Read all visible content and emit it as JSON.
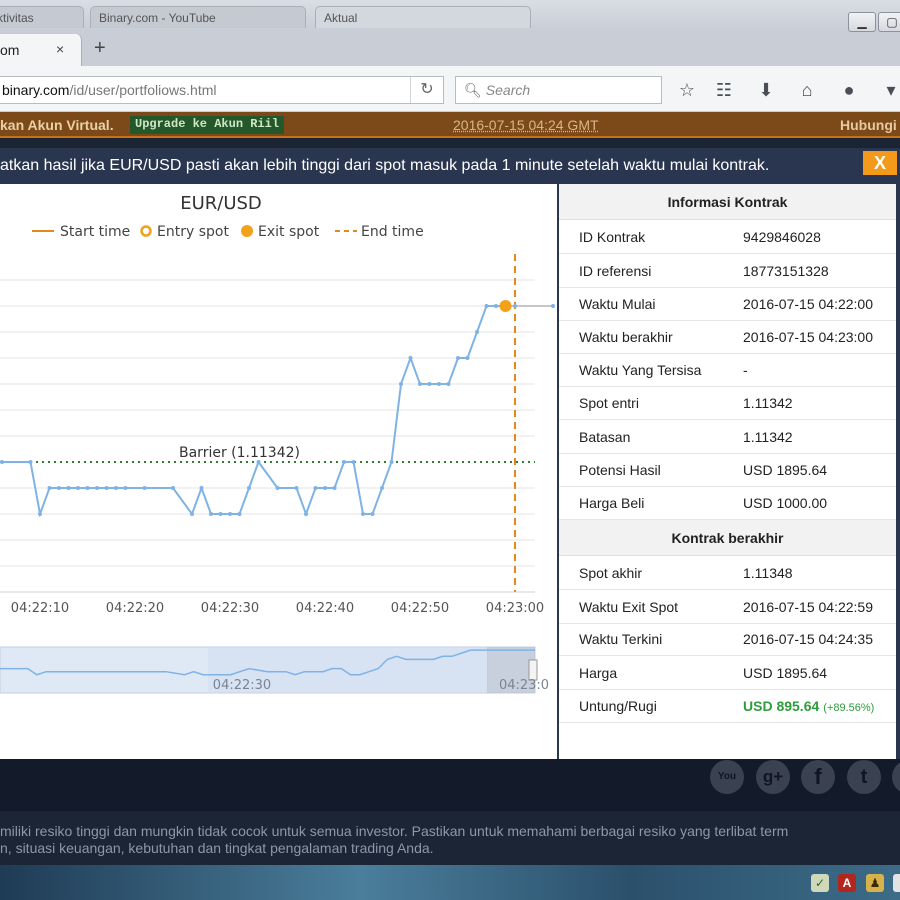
{
  "browser": {
    "tabs": [
      {
        "label": "Aktivitas"
      },
      {
        "label": "Binary.com - YouTube"
      },
      {
        "label": "Aktual"
      }
    ],
    "active_tab": {
      "label": "om",
      "close": "×"
    },
    "new_tab": "+",
    "url_host": "binary.com",
    "url_path": "/id/user/portfoliows.html",
    "search_placeholder": "Search",
    "window_buttons": {
      "minimize": "▁",
      "restore": "▢"
    }
  },
  "site_bar": {
    "left_text": "kan Akun Virtual.",
    "upgrade_label": "Upgrade ke Akun Riil",
    "server_time": "2016-07-15 04:24 GMT",
    "help_label": "Hubungi"
  },
  "dialog": {
    "message": "atkan hasil jika EUR/USD pasti akan lebih tinggi dari spot masuk pada 1 minute setelah waktu mulai kontrak.",
    "close_label": "X"
  },
  "chart_data": {
    "type": "line",
    "title": "EUR/USD",
    "legend": [
      "Start time",
      "Entry spot",
      "Exit spot",
      "End time"
    ],
    "legend_placement": "top",
    "barrier_label": "Barrier (1.11342)",
    "barrier": 1.11342,
    "exit_spot": 1.11348,
    "x_tick_labels": [
      "04:22:10",
      "04:22:20",
      "04:22:30",
      "04:22:40",
      "04:22:50",
      "04:23:00"
    ],
    "x_range_seconds": [
      6,
      64
    ],
    "ylim": [
      1.11337,
      1.1135
    ],
    "grid": true,
    "end_time_second": 60,
    "series": [
      {
        "x": [
          6,
          9,
          10,
          11,
          12,
          13,
          14,
          15,
          16,
          17,
          18,
          19,
          21,
          24,
          26,
          27,
          28,
          29,
          30,
          31,
          32,
          33,
          35,
          37,
          38,
          39,
          40,
          41,
          42,
          43,
          44,
          45,
          46,
          47,
          48,
          49,
          50,
          51,
          52,
          53,
          54,
          55,
          56,
          57,
          58,
          59,
          60,
          64
        ],
        "y": [
          1.11342,
          1.11342,
          1.1134,
          1.11341,
          1.11341,
          1.11341,
          1.11341,
          1.11341,
          1.11341,
          1.11341,
          1.11341,
          1.11341,
          1.11341,
          1.11341,
          1.1134,
          1.11341,
          1.1134,
          1.1134,
          1.1134,
          1.1134,
          1.11341,
          1.11342,
          1.11341,
          1.11341,
          1.1134,
          1.11341,
          1.11341,
          1.11341,
          1.11342,
          1.11342,
          1.1134,
          1.1134,
          1.11341,
          1.11342,
          1.11345,
          1.11346,
          1.11345,
          1.11345,
          1.11345,
          1.11345,
          1.11346,
          1.11346,
          1.11347,
          1.11348,
          1.11348,
          1.11348,
          1.11348,
          1.11348
        ]
      }
    ],
    "navigator_label": "04:22:30",
    "navigator_end_label": "04:23:0"
  },
  "contract_info": {
    "title": "Informasi Kontrak",
    "rows": [
      {
        "label": "ID Kontrak",
        "value": "9429846028"
      },
      {
        "label": "ID referensi",
        "value": "18773151328"
      },
      {
        "label": "Waktu Mulai",
        "value": "2016-07-15 04:22:00"
      },
      {
        "label": "Waktu berakhir",
        "value": "2016-07-15 04:23:00"
      },
      {
        "label": "Waktu Yang Tersisa",
        "value": "-"
      },
      {
        "label": "Spot entri",
        "value": "1.11342"
      },
      {
        "label": "Batasan",
        "value": "1.11342"
      },
      {
        "label": "Potensi Hasil",
        "value": "USD 1895.64"
      },
      {
        "label": "Harga Beli",
        "value": "USD 1000.00"
      }
    ]
  },
  "contract_result": {
    "title": "Kontrak berakhir",
    "rows": [
      {
        "label": "Spot akhir",
        "value": "1.11348"
      },
      {
        "label": "Waktu Exit Spot",
        "value": "2016-07-15 04:22:59"
      },
      {
        "label": "Waktu Terkini",
        "value": "2016-07-15 04:24:35"
      },
      {
        "label": "Harga",
        "value": "USD 1895.64"
      }
    ],
    "profit_label": "Untung/Rugi",
    "profit_value": "USD 895.64",
    "profit_pct": "(+89.56%)",
    "profit_color": "#2e9d3c"
  },
  "footer": {
    "social_icons": [
      "youtube-icon",
      "google-plus-icon",
      "facebook-icon",
      "twitter-icon"
    ],
    "social_glyphs": [
      "You",
      "g+",
      "f",
      "t"
    ],
    "disclaimer_line1": "miliki resiko tinggi dan mungkin tidak cocok untuk semua investor. Pastikan untuk memahami berbagai resiko yang terlibat term",
    "disclaimer_line2": "n, situasi keuangan, kebutuhan dan tingkat pengalaman trading Anda."
  },
  "colors": {
    "accent": "#f39a1a",
    "dialog_header": "#2a3550",
    "series_line": "#7fb3e6",
    "barrier": "#2e7d32",
    "end_time": "#e08a1e",
    "exit_spot": "#f3a11b"
  }
}
